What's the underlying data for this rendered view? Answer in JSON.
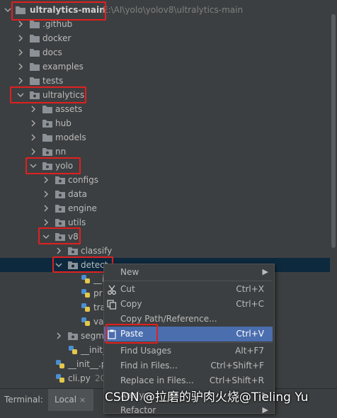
{
  "tree": {
    "root_label": "ultralytics-main",
    "root_path": "E:\\AI\\yolo\\yolov8\\ultralytics-main",
    "items": [
      {
        "label": ".github"
      },
      {
        "label": "docker"
      },
      {
        "label": "docs"
      },
      {
        "label": "examples"
      },
      {
        "label": "tests"
      },
      {
        "label": "ultralytics"
      },
      {
        "label": "assets"
      },
      {
        "label": "hub"
      },
      {
        "label": "models"
      },
      {
        "label": "nn"
      },
      {
        "label": "yolo"
      },
      {
        "label": "configs"
      },
      {
        "label": "data"
      },
      {
        "label": "engine"
      },
      {
        "label": "utils"
      },
      {
        "label": "v8"
      },
      {
        "label": "classify"
      },
      {
        "label": "detect"
      },
      {
        "label": "__i"
      },
      {
        "label": "pr"
      },
      {
        "label": "tra"
      },
      {
        "label": "va"
      },
      {
        "label": "segm"
      },
      {
        "label": "__init_"
      },
      {
        "label": "__init__.py"
      },
      {
        "label": "cli.py"
      }
    ],
    "cli_suffix": "20"
  },
  "bottom_bar": {
    "terminal_label": "Terminal:",
    "tab_local": "Local",
    "tab_close": "×"
  },
  "context_menu": {
    "items": [
      {
        "label": "New",
        "shortcut": ""
      },
      {
        "label": "Cut",
        "shortcut": "Ctrl+X"
      },
      {
        "label": "Copy",
        "shortcut": "Ctrl+C"
      },
      {
        "label": "Copy Path/Reference...",
        "shortcut": ""
      },
      {
        "label": "Paste",
        "shortcut": "Ctrl+V"
      },
      {
        "label": "Find Usages",
        "shortcut": "Alt+F7"
      },
      {
        "label": "Find in Files...",
        "shortcut": "Ctrl+Shift+F"
      },
      {
        "label": "Replace in Files...",
        "shortcut": "Ctrl+Shift+R"
      },
      {
        "label": "Analyze",
        "shortcut": ""
      },
      {
        "label": "Refactor",
        "shortcut": ""
      }
    ]
  },
  "watermark": "CSDN @拉磨的驴肉火烧@Tieling Yu",
  "colors": {
    "background": "#3c3f41",
    "selection": "#0d293e",
    "menu_active": "#4b6eaf",
    "highlight_box": "#e02020",
    "folder": "#8b9196"
  }
}
